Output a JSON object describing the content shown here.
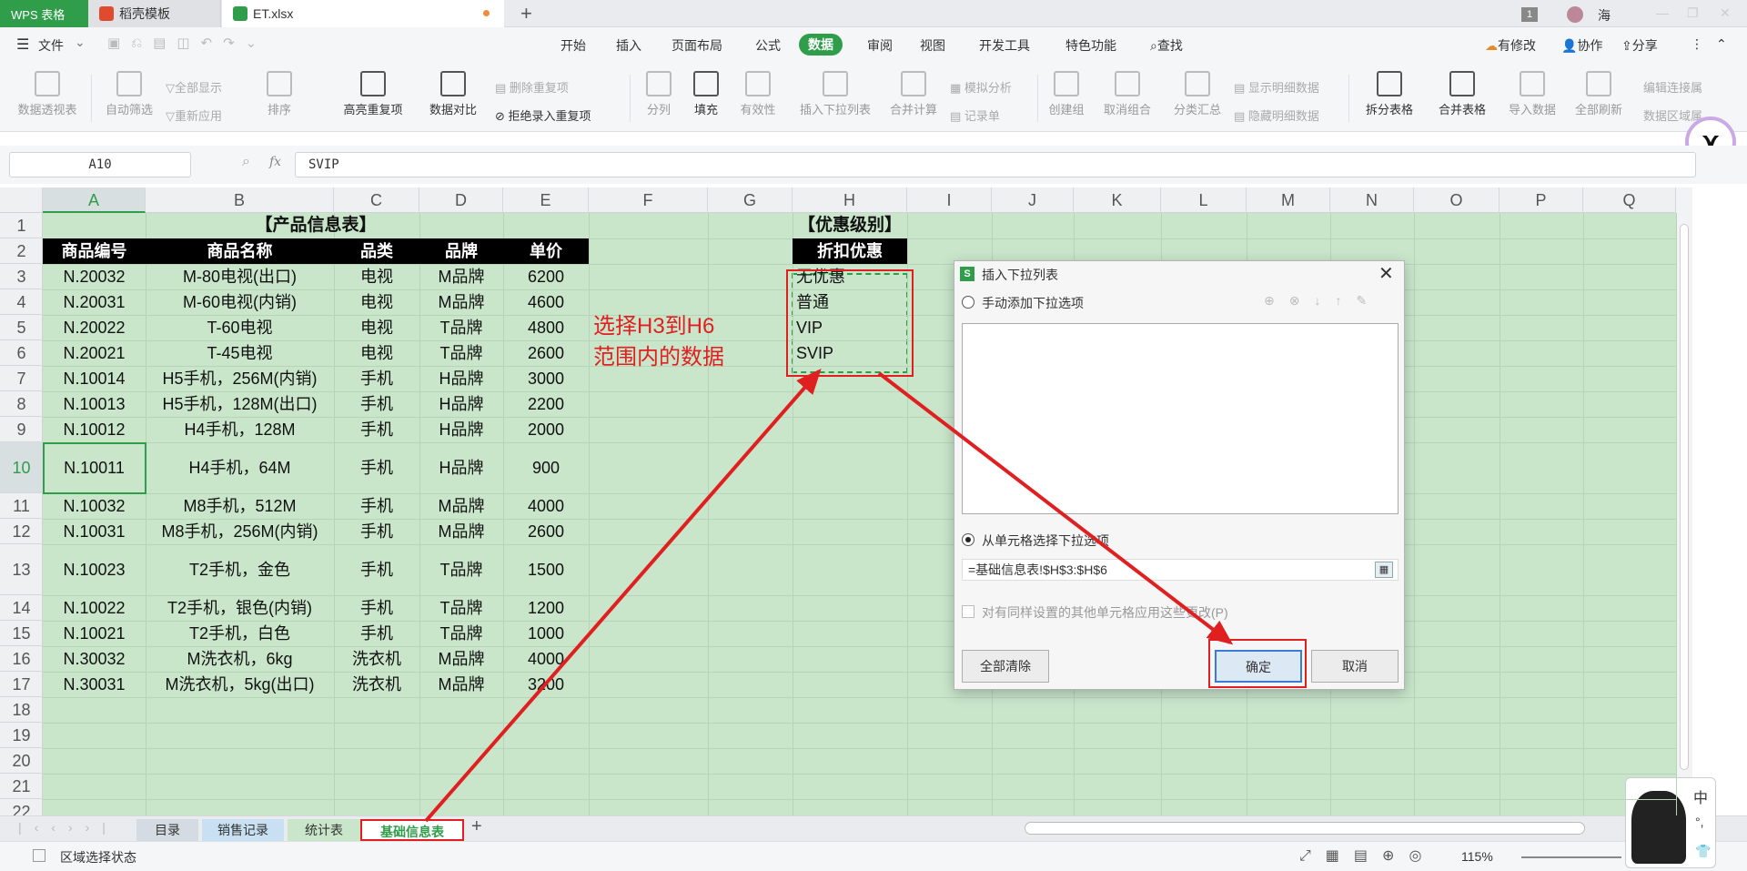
{
  "tabs": {
    "app": "WPS 表格",
    "template": "稻壳模板",
    "file": "ET.xlsx",
    "new_tab": "+",
    "page_badge": "1",
    "user": "海"
  },
  "menu": {
    "file": "文件",
    "items": [
      "开始",
      "插入",
      "页面布局",
      "公式",
      "数据",
      "审阅",
      "视图",
      "开发工具",
      "特色功能",
      "查找"
    ],
    "active": "数据",
    "right": [
      "有修改",
      "协作",
      "分享"
    ]
  },
  "ribbon": {
    "pivot": "数据透视表",
    "auto_filter": "自动筛选",
    "show_all": "全部显示",
    "reapply": "重新应用",
    "sort": "排序",
    "highlight_dup": "高亮重复项",
    "compare": "数据对比",
    "remove_dup": "删除重复项",
    "reject_dup": "拒绝录入重复项",
    "split": "分列",
    "fill": "填充",
    "validity": "有效性",
    "insert_dropdown": "插入下拉列表",
    "consolidate": "合并计算",
    "simulate": "模拟分析",
    "record": "记录单",
    "create_group": "创建组",
    "ungroup": "取消组合",
    "subtotal": "分类汇总",
    "show_detail": "显示明细数据",
    "hide_detail": "隐藏明细数据",
    "split_table": "拆分表格",
    "merge_table": "合并表格",
    "import": "导入数据",
    "refresh_all": "全部刷新",
    "edit_link": "编辑连接属",
    "data_area": "数据区域属"
  },
  "formula_bar": {
    "name_box": "A10",
    "fx": "fx",
    "content": "SVIP"
  },
  "columns": [
    "A",
    "B",
    "C",
    "D",
    "E",
    "F",
    "G",
    "H",
    "I",
    "J",
    "K",
    "L",
    "M",
    "N",
    "O",
    "P",
    "Q"
  ],
  "rows": [
    "1",
    "2",
    "3",
    "4",
    "5",
    "6",
    "7",
    "8",
    "9",
    "10",
    "11",
    "12",
    "13",
    "14",
    "15",
    "16",
    "17",
    "18",
    "19",
    "20",
    "21",
    "22"
  ],
  "table1": {
    "title": "【产品信息表】",
    "headers": [
      "商品编号",
      "商品名称",
      "品类",
      "品牌",
      "单价"
    ],
    "data": [
      [
        "N.20032",
        "M-80电视(出口)",
        "电视",
        "M品牌",
        "6200"
      ],
      [
        "N.20031",
        "M-60电视(内销)",
        "电视",
        "M品牌",
        "4600"
      ],
      [
        "N.20022",
        "T-60电视",
        "电视",
        "T品牌",
        "4800"
      ],
      [
        "N.20021",
        "T-45电视",
        "电视",
        "T品牌",
        "2600"
      ],
      [
        "N.10014",
        "H5手机，256M(内销)",
        "手机",
        "H品牌",
        "3000"
      ],
      [
        "N.10013",
        "H5手机，128M(出口)",
        "手机",
        "H品牌",
        "2200"
      ],
      [
        "N.10012",
        "H4手机，128M",
        "手机",
        "H品牌",
        "2000"
      ],
      [
        "N.10011",
        "H4手机，64M",
        "手机",
        "H品牌",
        "900"
      ],
      [
        "N.10032",
        "M8手机，512M",
        "手机",
        "M品牌",
        "4000"
      ],
      [
        "N.10031",
        "M8手机，256M(内销)",
        "手机",
        "M品牌",
        "2600"
      ],
      [
        "N.10023",
        "T2手机，金色",
        "手机",
        "T品牌",
        "1500"
      ],
      [
        "N.10022",
        "T2手机，银色(内销)",
        "手机",
        "T品牌",
        "1200"
      ],
      [
        "N.10021",
        "T2手机，白色",
        "手机",
        "T品牌",
        "1000"
      ],
      [
        "N.30032",
        "M洗衣机，6kg",
        "洗衣机",
        "M品牌",
        "4000"
      ],
      [
        "N.30031",
        "M洗衣机，5kg(出口)",
        "洗衣机",
        "M品牌",
        "3200"
      ]
    ]
  },
  "table2": {
    "title": "【优惠级别】",
    "header": "折扣优惠",
    "items": [
      "无优惠",
      "普通",
      "VIP",
      "SVIP"
    ]
  },
  "annotation": {
    "line1": "选择H3到H6",
    "line2": "范围内的数据"
  },
  "dialog": {
    "title": "插入下拉列表",
    "opt_manual": "手动添加下拉选项",
    "opt_cells": "从单元格选择下拉选项",
    "range": "=基础信息表!$H$3:$H$6",
    "apply_all": "对有同样设置的其他单元格应用这些更改(P)",
    "clear_all": "全部清除",
    "ok": "确定",
    "cancel": "取消"
  },
  "sheets": [
    "目录",
    "销售记录",
    "统计表",
    "基础信息表"
  ],
  "active_sheet": "基础信息表",
  "status": {
    "mode": "区域选择状态",
    "zoom": "115%"
  },
  "ime": {
    "lang": "中",
    "punct": "°,"
  },
  "colors": {
    "accent": "#2f9d4a",
    "annotation": "#e02020",
    "grid_bg": "#c9e6cb"
  }
}
